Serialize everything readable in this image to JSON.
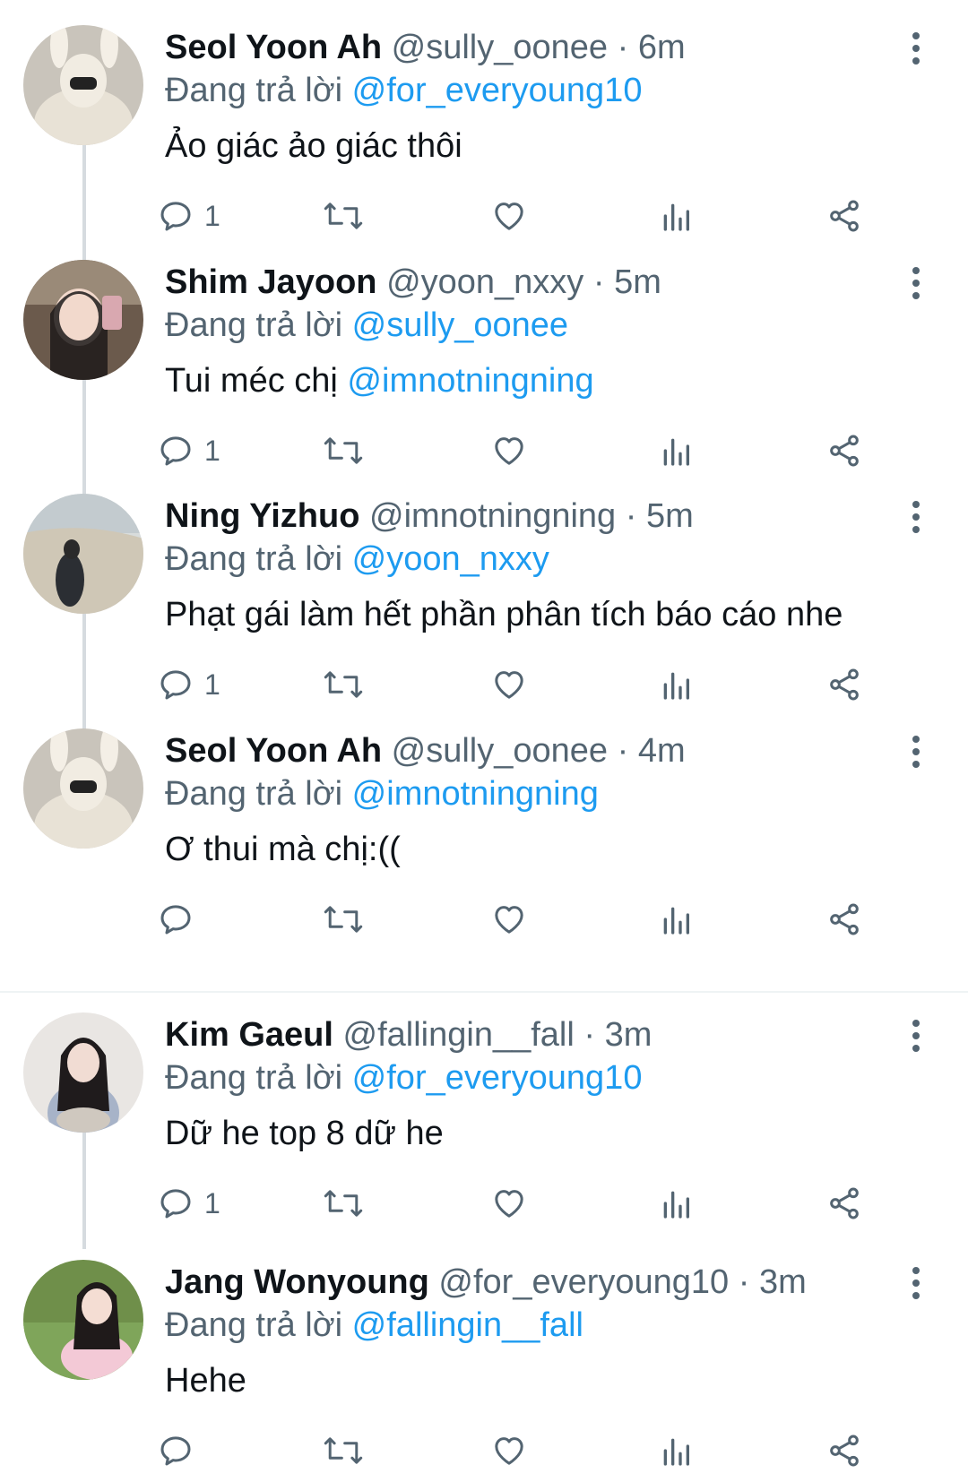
{
  "replying_label": "Đang trả lời",
  "colors": {
    "link": "#1d9bf0",
    "secondary": "#536471",
    "text": "#0f1419",
    "thread_line": "#d6dbdf"
  },
  "icons": [
    "reply-icon",
    "retweet-icon",
    "like-icon",
    "views-icon",
    "share-icon",
    "more-icon"
  ],
  "tweets": [
    {
      "name": "Seol Yoon Ah",
      "handle": "@sully_oonee",
      "dot": "·",
      "time": "6m",
      "replying_to": "@for_everyoung10",
      "text": "Ảo giác ảo giác thôi",
      "mention": "",
      "reply_count": "1"
    },
    {
      "name": "Shim Jayoon",
      "handle": "@yoon_nxxy",
      "dot": "·",
      "time": "5m",
      "replying_to": "@sully_oonee",
      "text": "Tui méc chị",
      "mention": "@imnotningning",
      "reply_count": "1"
    },
    {
      "name": "Ning Yizhuo",
      "handle": "@imnotningning",
      "dot": "·",
      "time": "5m",
      "replying_to": "@yoon_nxxy",
      "text": "Phạt gái làm hết phần phân tích báo cáo nhe",
      "mention": "",
      "reply_count": "1"
    },
    {
      "name": "Seol Yoon Ah",
      "handle": "@sully_oonee",
      "dot": "·",
      "time": "4m",
      "replying_to": "@imnotningning",
      "text": "Ơ thui mà chị:((",
      "mention": "",
      "reply_count": ""
    },
    {
      "name": "Kim Gaeul",
      "handle": "@fallingin__fall",
      "dot": "·",
      "time": "3m",
      "replying_to": "@for_everyoung10",
      "text": "Dữ he top 8 dữ he",
      "mention": "",
      "reply_count": "1"
    },
    {
      "name": "Jang Wonyoung",
      "handle": "@for_everyoung10",
      "dot": "·",
      "time": "3m",
      "replying_to": "@fallingin__fall",
      "text": "Hehe",
      "mention": "",
      "reply_count": ""
    }
  ]
}
